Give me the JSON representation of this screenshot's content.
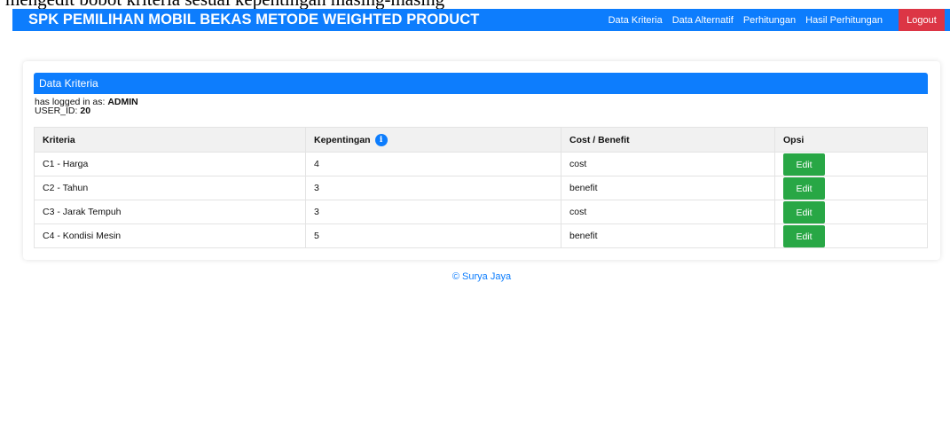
{
  "caption": "mengedit bobot kriteria sesuai kepentingan masing-masing",
  "navbar": {
    "brand": "SPK PEMILIHAN MOBIL BEKAS METODE WEIGHTED PRODUCT",
    "links": [
      "Data Kriteria",
      "Data Alternatif",
      "Perhitungan",
      "Hasil Perhitungan"
    ],
    "logout_label": "Logout"
  },
  "card": {
    "title": "Data Kriteria",
    "login_prefix": "has logged in as: ",
    "login_user": "ADMIN",
    "userid_prefix": "USER_ID: ",
    "userid_value": "20"
  },
  "table": {
    "headers": [
      "Kriteria",
      "Kepentingan",
      "Cost / Benefit",
      "Opsi"
    ],
    "info_icon_glyph": "i",
    "rows": [
      {
        "kriteria": "C1 - Harga",
        "kepentingan": "4",
        "type": "cost",
        "action": "Edit"
      },
      {
        "kriteria": "C2 - Tahun",
        "kepentingan": "3",
        "type": "benefit",
        "action": "Edit"
      },
      {
        "kriteria": "C3 - Jarak Tempuh",
        "kepentingan": "3",
        "type": "cost",
        "action": "Edit"
      },
      {
        "kriteria": "C4 - Kondisi Mesin",
        "kepentingan": "5",
        "type": "benefit",
        "action": "Edit"
      }
    ]
  },
  "footer": "© Surya Jaya",
  "colors": {
    "primary": "#0d7dfd",
    "danger": "#dc3545",
    "success": "#28a745"
  },
  "icons": {
    "info": "info-icon"
  }
}
